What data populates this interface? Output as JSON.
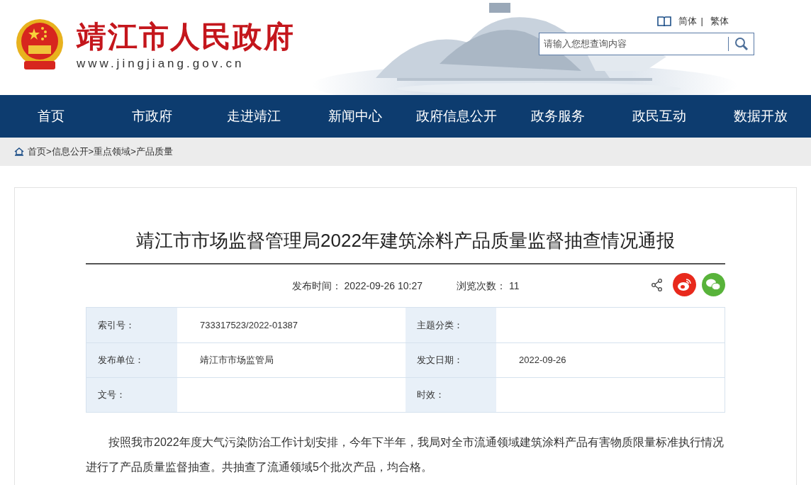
{
  "header": {
    "site_title": "靖江市人民政府",
    "site_url": "www.jingjiang.gov.cn",
    "languages": [
      {
        "label": "简体"
      },
      {
        "label": "繁体"
      }
    ],
    "language_separator": "|",
    "search": {
      "placeholder": "请输入您想查询内容"
    }
  },
  "nav": [
    {
      "label": "首页"
    },
    {
      "label": "市政府"
    },
    {
      "label": "走进靖江"
    },
    {
      "label": "新闻中心"
    },
    {
      "label": "政府信息公开"
    },
    {
      "label": "政务服务"
    },
    {
      "label": "政民互动"
    },
    {
      "label": "数据开放"
    }
  ],
  "breadcrumb": {
    "separator": ">",
    "items": [
      "首页",
      "信息公开",
      "重点领域",
      "产品质量"
    ]
  },
  "article": {
    "title": "靖江市市场监督管理局2022年建筑涂料产品质量监督抽查情况通报",
    "meta": [
      {
        "label": "发布时间：",
        "value": "2022-09-26 10:27"
      },
      {
        "label": "浏览次数：",
        "value": "11"
      }
    ],
    "info_table": [
      [
        {
          "label": "索引号：",
          "value": "733317523/2022-01387"
        },
        {
          "label": "主题分类："
        }
      ],
      [
        {
          "label": "发布单位：",
          "value": "靖江市市场监管局"
        },
        {
          "label": "发文日期：",
          "value": "2022-09-26"
        }
      ],
      [
        {
          "label": "文号："
        },
        {
          "label": "时效："
        }
      ]
    ],
    "body": "按照我市2022年度大气污染防治工作计划安排，今年下半年，我局对全市流通领域建筑涂料产品有害物质限量标准执行情况进行了产品质量监督抽查。共抽查了流通领域5个批次产品，均合格。"
  }
}
